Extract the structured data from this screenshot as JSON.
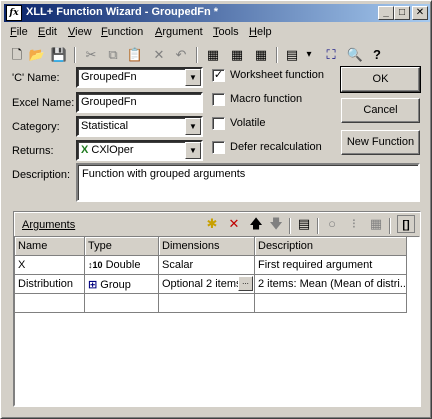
{
  "window": {
    "title": "XLL+ Function Wizard - GroupedFn *",
    "icon_text": "fx",
    "controls": {
      "minimize": "_",
      "maximize": "□",
      "close": "✕"
    }
  },
  "menu": [
    {
      "label": "File",
      "accel": "F",
      "rest": "ile"
    },
    {
      "label": "Edit",
      "accel": "E",
      "rest": "dit"
    },
    {
      "label": "View",
      "accel": "V",
      "rest": "iew"
    },
    {
      "label": "Function",
      "accel": "F",
      "rest": "unction"
    },
    {
      "label": "Argument",
      "accel": "A",
      "rest": "rgument"
    },
    {
      "label": "Tools",
      "accel": "T",
      "rest": "ools"
    },
    {
      "label": "Help",
      "accel": "H",
      "rest": "elp"
    }
  ],
  "toolbar": {
    "new": "🗋",
    "open": "📂",
    "save": "💾",
    "cut": "✂",
    "copy": "⧉",
    "paste": "📋",
    "delete": "✕",
    "undo": "↶",
    "t1": "▦",
    "t2": "▦",
    "t3": "▦",
    "props": "▤",
    "dropdown": "▾",
    "group": "⛶",
    "find": "🔍",
    "help": "?"
  },
  "form": {
    "c_name_label": "'C' Name:",
    "c_name_value": "GroupedFn",
    "excel_name_label": "Excel Name:",
    "excel_name_value": "GroupedFn",
    "category_label": "Category:",
    "category_value": "Statistical",
    "returns_label": "Returns:",
    "returns_value": "CXlOper",
    "description_label": "Description:",
    "description_value": "Function with grouped arguments",
    "worksheet_function": "Worksheet function",
    "macro_function": "Macro function",
    "volatile": "Volatile",
    "defer_recalculation": "Defer recalculation",
    "check_mark": "✓",
    "combo_arrow": "▼"
  },
  "buttons": {
    "ok": "OK",
    "cancel": "Cancel",
    "new_function": "New Function"
  },
  "arguments": {
    "title": "Arguments",
    "toolbar": {
      "add": "✱",
      "remove": "✕",
      "up": "🡅",
      "down": "🡇",
      "props": "▤",
      "circle": "○",
      "bar": "⁝",
      "grid": "▦",
      "brackets": "[]"
    },
    "columns": [
      "Name",
      "Type",
      "Dimensions",
      "Description"
    ],
    "rows": [
      {
        "name": "X",
        "type_icon": "↕10",
        "type": "Double",
        "dimensions": "Scalar",
        "description": "First required argument"
      },
      {
        "name": "Distribution",
        "type_icon": "⊞",
        "type": "Group",
        "dimensions": "Optional 2 items",
        "ellipsis": "...",
        "description": "2 items: Mean (Mean of distri..."
      }
    ]
  }
}
